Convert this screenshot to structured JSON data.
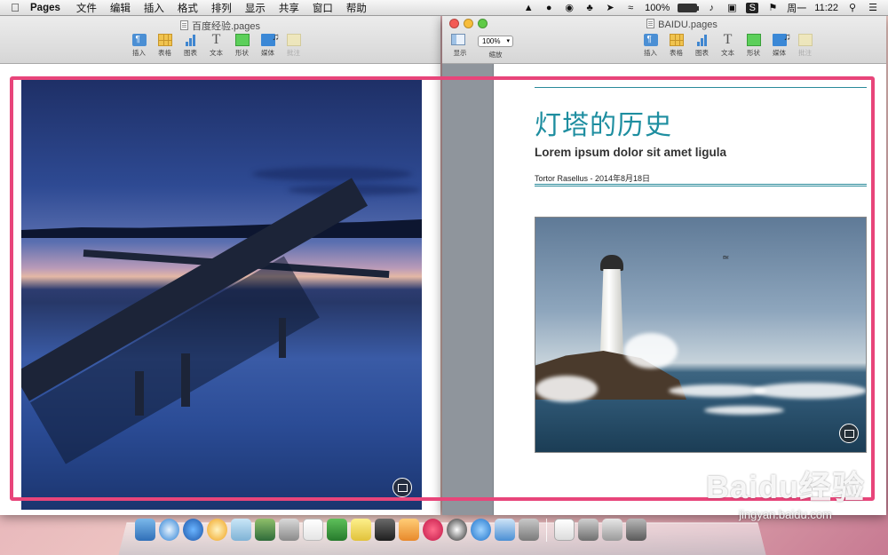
{
  "menubar": {
    "app_name": "Pages",
    "menus": [
      "文件",
      "编辑",
      "插入",
      "格式",
      "排列",
      "显示",
      "共享",
      "窗口",
      "帮助"
    ],
    "battery_percent": "100%",
    "day": "周一",
    "time": "11:22"
  },
  "left_window": {
    "title": "百度经验.pages",
    "tools": [
      "插入",
      "表格",
      "图表",
      "文本",
      "形状",
      "媒体",
      "批注"
    ]
  },
  "right_window": {
    "title": "BAIDU.pages",
    "view_label": "显示",
    "zoom_value": "100%",
    "zoom_label": "缩放",
    "tools": [
      "插入",
      "表格",
      "图表",
      "文本",
      "形状",
      "媒体",
      "批注"
    ],
    "document": {
      "title": "灯塔的历史",
      "subtitle": "Lorem ipsum dolor sit amet ligula",
      "byline": "Tortor Rasellus - 2014年8月18日"
    }
  },
  "watermark": {
    "logo": "Baidu经验",
    "url": "jingyan.baidu.com"
  },
  "colors": {
    "highlight": "#e8457a",
    "doc_title": "#1e8ea0"
  }
}
